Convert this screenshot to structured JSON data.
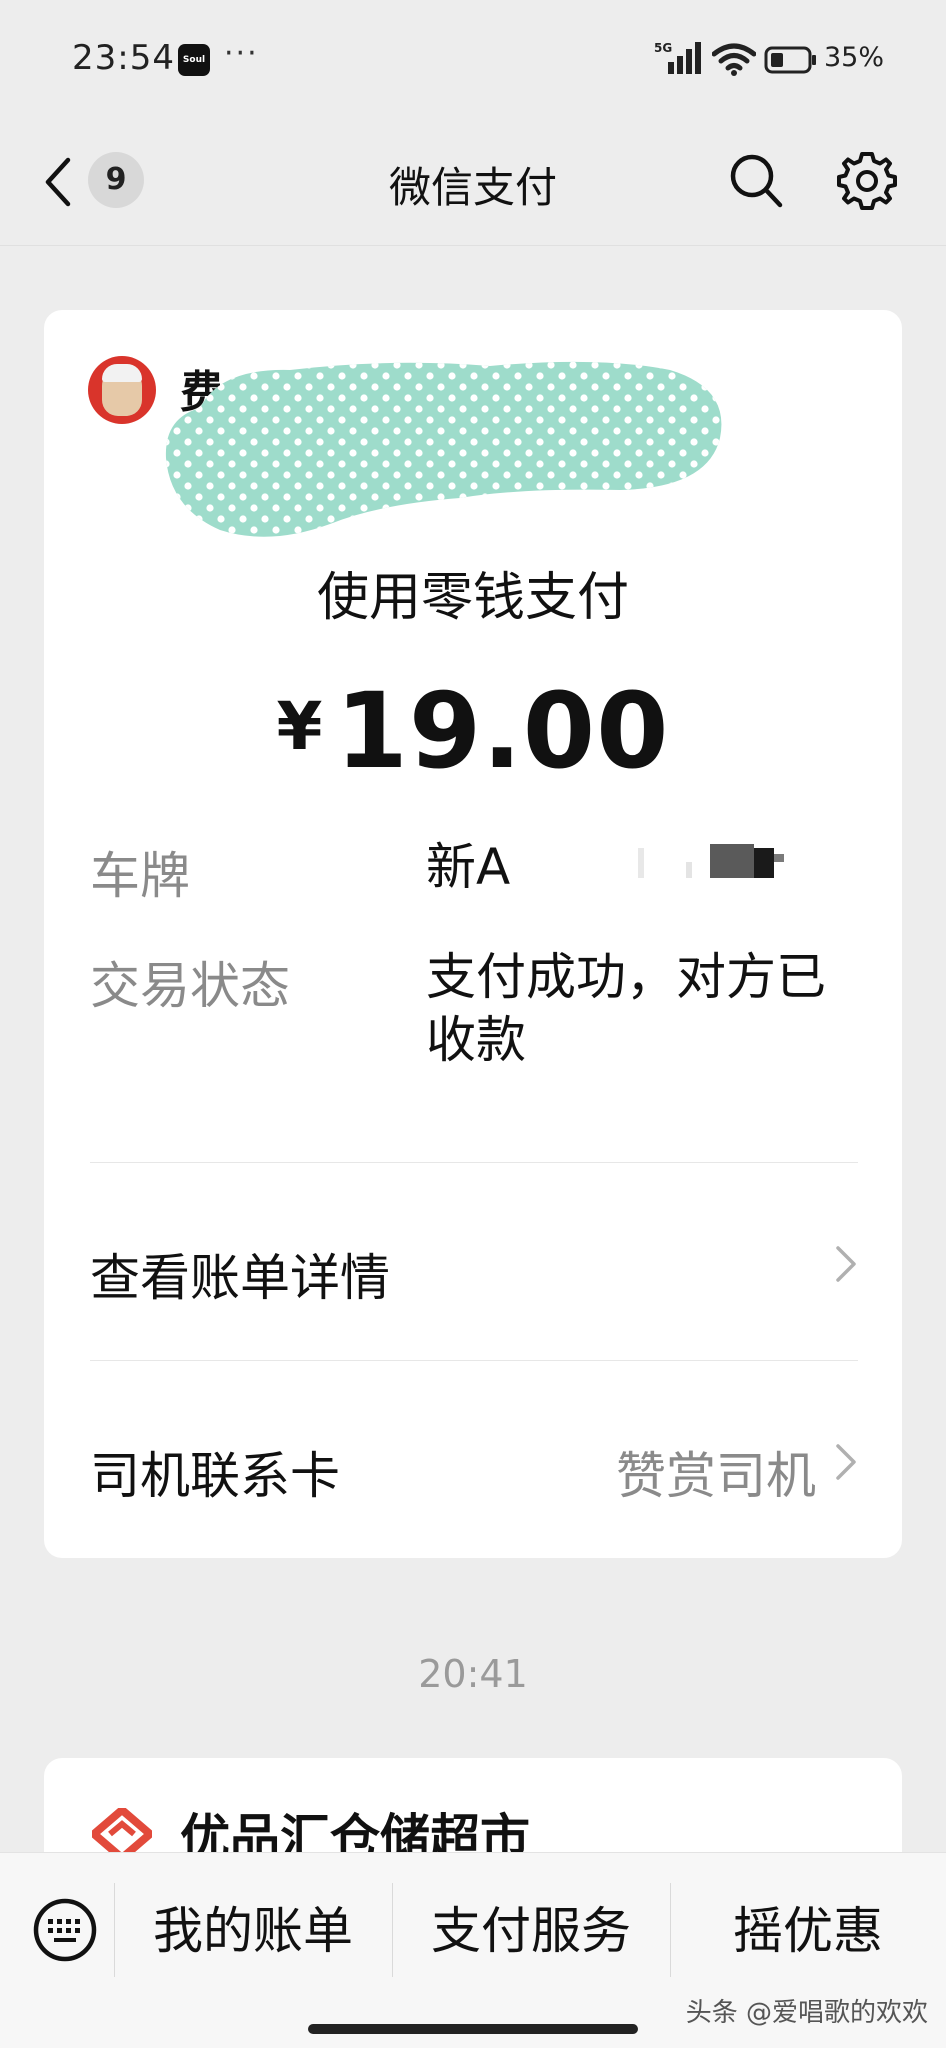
{
  "status_bar": {
    "time": "23:54",
    "app_icon_text": "Soul",
    "more": "···",
    "network": "5G",
    "battery": "35%"
  },
  "nav": {
    "unread_count": "9",
    "title": "微信支付"
  },
  "payment": {
    "merchant_name_visible": "费",
    "method": "使用零钱支付",
    "currency": "¥",
    "amount": "19.00",
    "plate_label": "车牌",
    "plate_value": "新A",
    "status_label": "交易状态",
    "status_value": "支付成功，对方已收款",
    "bill_detail": "查看账单详情",
    "driver_card": "司机联系卡",
    "tip_driver": "赞赏司机"
  },
  "chat": {
    "time": "20:41",
    "next_merchant": "优品汇仓储超市"
  },
  "bottom_menu": {
    "items": [
      "我的账单",
      "支付服务",
      "摇优惠"
    ]
  },
  "watermark": "头条 @爱唱歌的欢欢",
  "colors": {
    "background": "#EDEDED",
    "card": "#FFFFFF",
    "redaction": "#9EDCCB",
    "store_logo": "#E24A3B"
  }
}
